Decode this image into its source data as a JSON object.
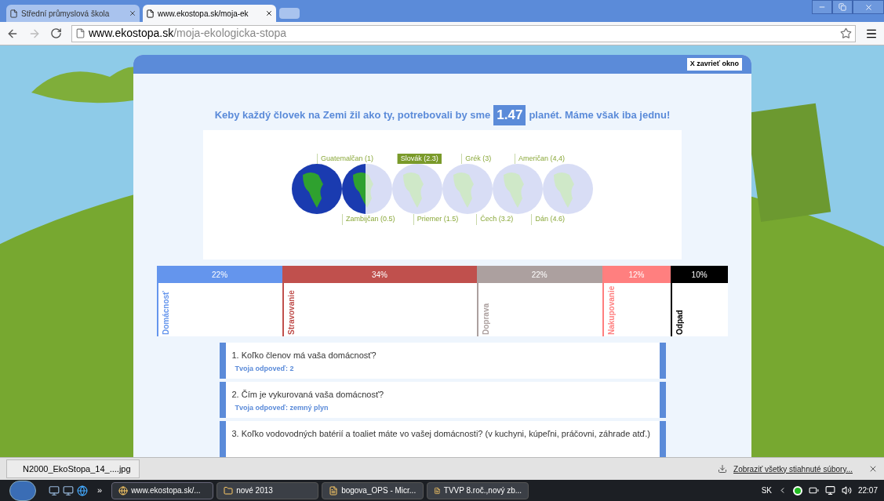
{
  "browser": {
    "tabs": [
      {
        "title": "Střední průmyslová škola",
        "selected": false
      },
      {
        "title": "www.ekostopa.sk/moja-ek",
        "selected": true
      }
    ],
    "url_domain": "www.ekostopa.sk",
    "url_path": "/moja-ekologicka-stopa"
  },
  "dialog": {
    "close_button": "X zavrieť okno",
    "headline_before": "Keby každý človek na Zemi žil ako ty, potrebovali by sme",
    "planets": "1.47",
    "headline_after": "planét. Máme však iba jednu!",
    "globe_meter": {
      "level": 0.245
    },
    "top_labels": [
      {
        "text": "Guatemalčan (1)",
        "selected": false
      },
      {
        "text": "Slovák  (2.3)",
        "selected": true
      },
      {
        "text": "Grék (3)",
        "selected": false
      },
      {
        "text": "Američan (4,4)",
        "selected": false
      }
    ],
    "bottom_labels": [
      {
        "text": "Zambijčan (0.5)",
        "selected": false
      },
      {
        "text": "Priemer (1.5)",
        "selected": false
      },
      {
        "text": "Čech (3.2)",
        "selected": false
      },
      {
        "text": "Dán (4.6)",
        "selected": false
      }
    ],
    "categories": [
      {
        "percent": "22%",
        "label": "Domácnosť",
        "color": "#6495ed"
      },
      {
        "percent": "34%",
        "label": "Stravovanie",
        "color": "#c0504d"
      },
      {
        "percent": "22%",
        "label": "Doprava",
        "color": "#aca09f"
      },
      {
        "percent": "12%",
        "label": "Nakupovanie",
        "color": "#ff7f7f"
      },
      {
        "percent": "10%",
        "label": "Odpad",
        "color": "#000000"
      }
    ],
    "questions": [
      {
        "question": "1. Koľko členov má vaša domácnosť?",
        "answer": "Tvoja odpoveď: 2"
      },
      {
        "question": "2. Čím je vykurovaná vaša domácnosť?",
        "answer": "Tvoja odpoveď: zemný plyn"
      },
      {
        "question": "3. Koľko vodovodných batérií a toaliet máte vo vašej domácnosti? (v kuchyni, kúpeľni, práčovni, záhrade atď.)"
      }
    ]
  },
  "downloads": {
    "file": "N2000_EkoStopa_14_....jpg",
    "show_all": "Zobraziť všetky stiahnuté súbory..."
  },
  "taskbar": {
    "overflow": "»",
    "items": [
      {
        "label": "www.ekostopa.sk/...",
        "selected": true
      },
      {
        "label": "nové 2013",
        "selected": false
      },
      {
        "label": "bogova_OPS - Micr...",
        "selected": false
      },
      {
        "label": "TVVP 8.roč.,nový zb...",
        "selected": false
      }
    ],
    "language": "SK",
    "time": "22:07"
  }
}
